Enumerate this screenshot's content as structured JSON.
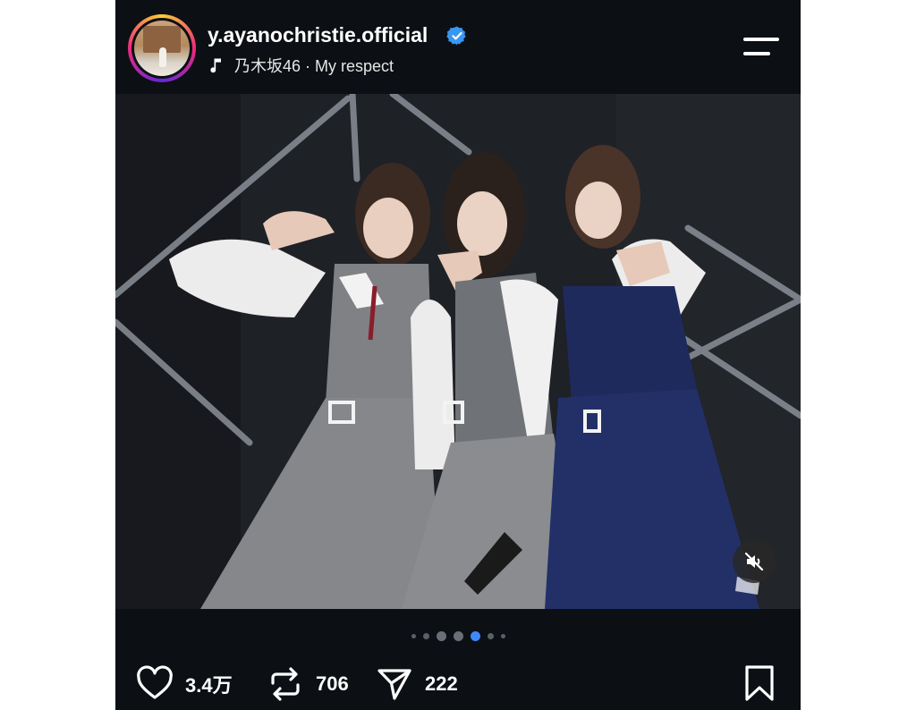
{
  "post": {
    "username": "y.ayanochristie.official",
    "verified": true,
    "music": {
      "icon": "music-note-icon",
      "text": "乃木坂46 · My respect"
    },
    "menu_icon": "menu-icon"
  },
  "media": {
    "description_icon": "photo",
    "mute_icon": "mute-icon",
    "carousel": {
      "total_dots": 7,
      "active_index": 4
    }
  },
  "actions": {
    "likes": "3.4万",
    "reposts": "706",
    "shares": "222",
    "like_icon": "heart-icon",
    "repost_icon": "repost-icon",
    "share_icon": "send-icon",
    "save_icon": "bookmark-icon"
  },
  "colors": {
    "background": "#0c0f14",
    "accent": "#3f88f7",
    "verified": "#3897f0"
  }
}
